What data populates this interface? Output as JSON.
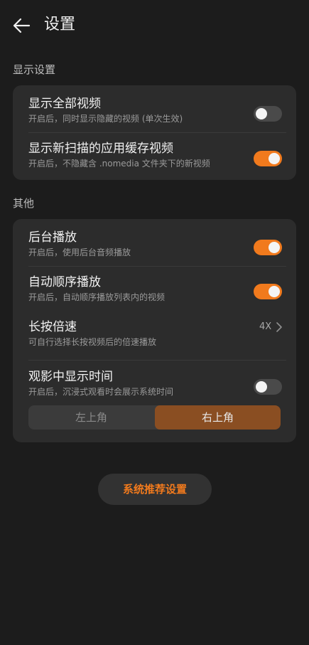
{
  "header": {
    "title": "设置"
  },
  "sections": {
    "display": {
      "label": "显示设置",
      "rows": [
        {
          "title": "显示全部视频",
          "subtitle": "开启后，同时显示隐藏的视频 (单次生效)",
          "toggle_on": false
        },
        {
          "title": "显示新扫描的应用缓存视频",
          "subtitle": "开启后，不隐藏含 .nomedia 文件夹下的新视频",
          "toggle_on": true
        }
      ]
    },
    "other": {
      "label": "其他",
      "rows": [
        {
          "title": "后台播放",
          "subtitle": "开启后，使用后台音频播放",
          "toggle_on": true
        },
        {
          "title": "自动顺序播放",
          "subtitle": "开启后，自动顺序播放列表内的视频",
          "toggle_on": true
        },
        {
          "title": "长按倍速",
          "subtitle": "可自行选择长按视频后的倍速播放",
          "value": "4X"
        },
        {
          "title": "观影中显示时间",
          "subtitle": "开启后，沉浸式观看时会展示系统时间",
          "toggle_on": false
        }
      ],
      "time_position": {
        "options": [
          "左上角",
          "右上角"
        ],
        "selected": "右上角"
      }
    }
  },
  "footer_button": {
    "label": "系统推荐设置"
  },
  "colors": {
    "accent": "#f17a1d",
    "background": "#1c1c1c",
    "card": "#2c2c2c",
    "segment_active": "#8a4e22"
  },
  "icons": {
    "back": "arrow-left-icon",
    "chevron": "chevron-right-icon"
  }
}
